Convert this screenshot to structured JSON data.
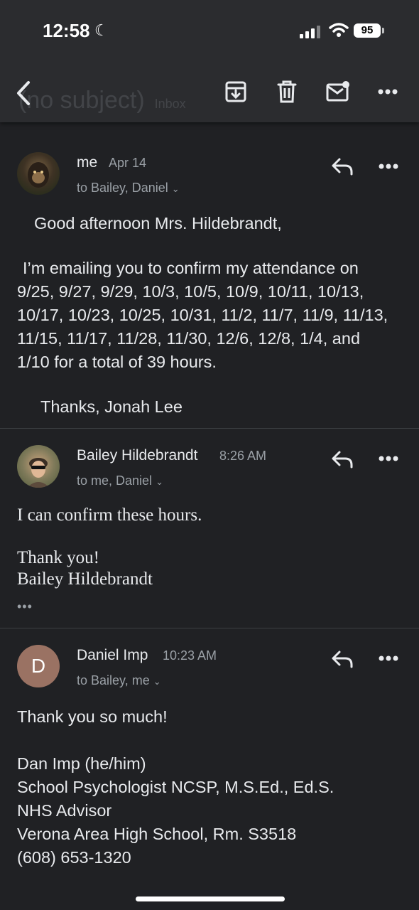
{
  "status_bar": {
    "time": "12:58",
    "battery": "95"
  },
  "header": {
    "subject": "(no subject)",
    "label": "Inbox"
  },
  "messages": [
    {
      "sender": "me",
      "date": "Apr 14",
      "recipients": "to Bailey, Daniel",
      "body": [
        "Good afternoon Mrs. Hildebrandt,",
        "I’m emailing you to confirm my attendance on",
        "9/25, 9/27, 9/29, 10/3, 10/5, 10/9, 10/11, 10/13,",
        "10/17, 10/23, 10/25, 10/31, 11/2, 11/7, 11/9, 11/13,",
        "11/15, 11/17, 11/28, 11/30, 12/6, 12/8, 1/4, and",
        "1/10 for a total of 39 hours.",
        "Thanks, Jonah Lee"
      ]
    },
    {
      "sender": "Bailey Hildebrandt",
      "date": "8:26 AM",
      "recipients": "to me, Daniel",
      "body": [
        "I can confirm these hours.",
        "Thank you!",
        "Bailey Hildebrandt"
      ],
      "trimmed_content": "•••"
    },
    {
      "sender": "Daniel Imp",
      "initial": "D",
      "date": "10:23 AM",
      "recipients": "to Bailey, me",
      "body": [
        "Thank you so much!",
        "Dan Imp (he/him)",
        "School Psychologist NCSP, M.S.Ed., Ed.S.",
        "NHS Advisor",
        "Verona Area High School, Rm. S3518",
        "(608) 653-1320"
      ]
    }
  ],
  "colors": {
    "background": "#202124",
    "toolbar": "#2b2c2f",
    "avatar_d": "#9a7263"
  }
}
